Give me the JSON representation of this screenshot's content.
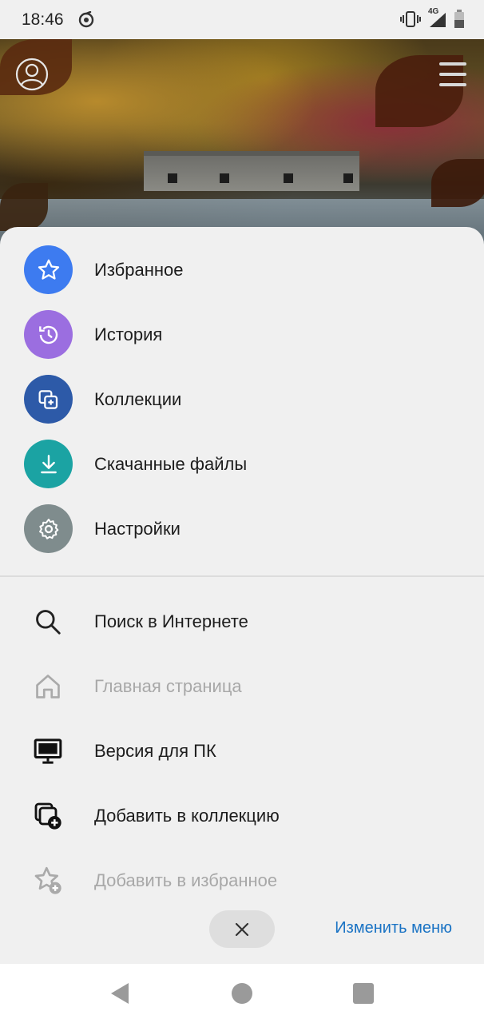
{
  "status_bar": {
    "time": "18:46",
    "network": "4G",
    "icons": [
      "shazam-icon",
      "vibrate-icon",
      "signal-icon",
      "battery-icon"
    ]
  },
  "header": {
    "profile_icon": "profile-icon",
    "menu_icon": "hamburger-icon"
  },
  "menu": {
    "primary_items": [
      {
        "label": "Избранное",
        "icon": "star-icon",
        "color": "#3d7bf0"
      },
      {
        "label": "История",
        "icon": "history-icon",
        "color": "#9b6ee0"
      },
      {
        "label": "Коллекции",
        "icon": "collections-icon",
        "color": "#2d5aa8"
      },
      {
        "label": "Скачанные файлы",
        "icon": "download-icon",
        "color": "#1ba3a3"
      },
      {
        "label": "Настройки",
        "icon": "gear-icon",
        "color": "#7f8c8d"
      }
    ],
    "secondary_items": [
      {
        "label": "Поиск в Интернете",
        "icon": "search-icon",
        "enabled": true
      },
      {
        "label": "Главная страница",
        "icon": "home-icon",
        "enabled": false
      },
      {
        "label": "Версия для ПК",
        "icon": "desktop-icon",
        "enabled": true
      },
      {
        "label": "Добавить в коллекцию",
        "icon": "add-collection-icon",
        "enabled": true
      },
      {
        "label": "Добавить в избранное",
        "icon": "add-favorite-icon",
        "enabled": false
      }
    ]
  },
  "footer": {
    "close_icon": "close-icon",
    "edit_menu_label": "Изменить меню"
  },
  "nav_bar": {
    "icons": [
      "back-icon",
      "home-nav-icon",
      "recents-icon"
    ]
  }
}
